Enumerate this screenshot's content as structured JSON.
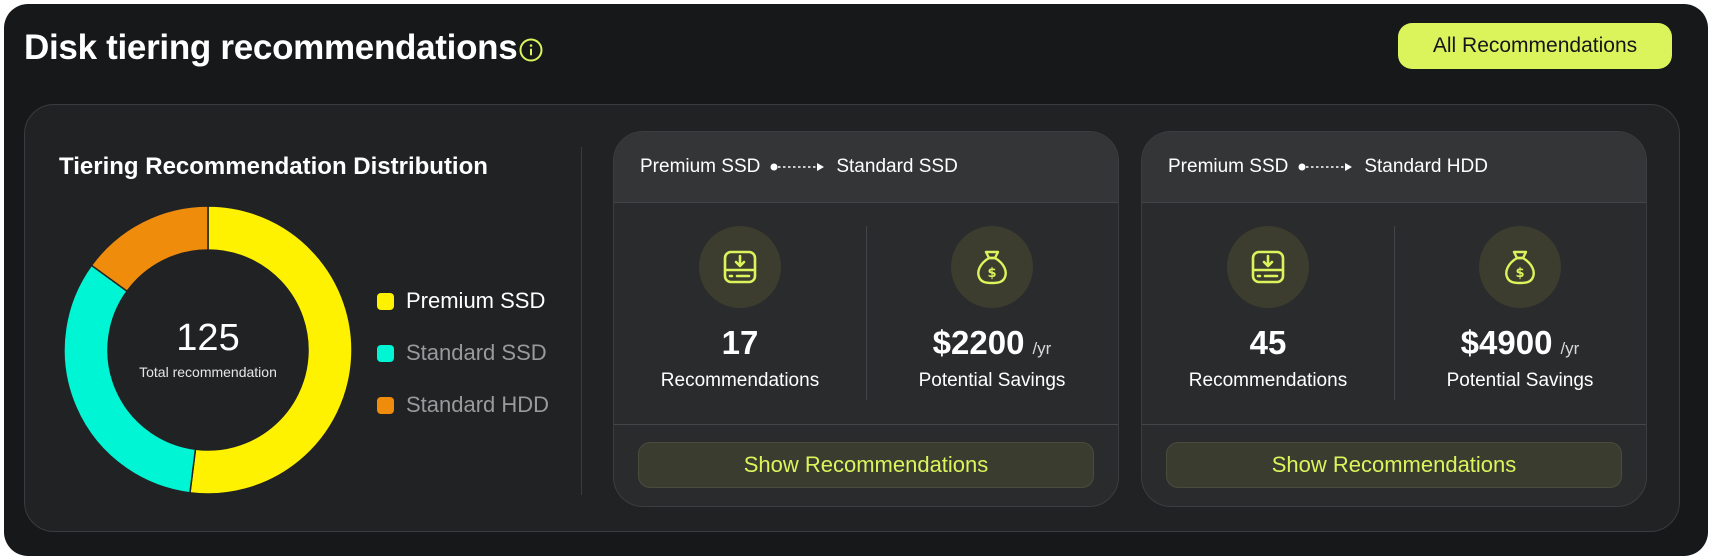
{
  "header": {
    "title": "Disk tiering recommendations",
    "info_icon": "info-circle-icon",
    "all_button_label": "All Recommendations"
  },
  "colors": {
    "accent": "#dcf45c",
    "premium_ssd": "#fff200",
    "standard_ssd": "#00f5d4",
    "standard_hdd": "#f08c0c"
  },
  "distribution": {
    "title": "Tiering Recommendation Distribution",
    "total": "125",
    "total_label": "Total recommendation",
    "legend": [
      {
        "label": "Premium SSD",
        "color": "#fff200",
        "active": true
      },
      {
        "label": "Standard SSD",
        "color": "#00f5d4",
        "active": false
      },
      {
        "label": "Standard HDD",
        "color": "#f08c0c",
        "active": false
      }
    ],
    "segments": [
      {
        "name": "Premium SSD",
        "share": 0.52,
        "color": "#fff200"
      },
      {
        "name": "Standard SSD",
        "share": 0.33,
        "color": "#00f5d4"
      },
      {
        "name": "Standard HDD",
        "share": 0.15,
        "color": "#f08c0c"
      }
    ]
  },
  "cards": [
    {
      "from": "Premium SSD",
      "to": "Standard SSD",
      "recommendations": "17",
      "recommendations_label": "Recommendations",
      "savings": "$2200",
      "savings_unit": "/yr",
      "savings_label": "Potential Savings",
      "button_label": "Show Recommendations",
      "icons": [
        "disk-download-icon",
        "money-bag-icon"
      ]
    },
    {
      "from": "Premium SSD",
      "to": "Standard HDD",
      "recommendations": "45",
      "recommendations_label": "Recommendations",
      "savings": "$4900",
      "savings_unit": "/yr",
      "savings_label": "Potential Savings",
      "button_label": "Show Recommendations",
      "icons": [
        "disk-download-icon",
        "money-bag-icon"
      ]
    }
  ]
}
